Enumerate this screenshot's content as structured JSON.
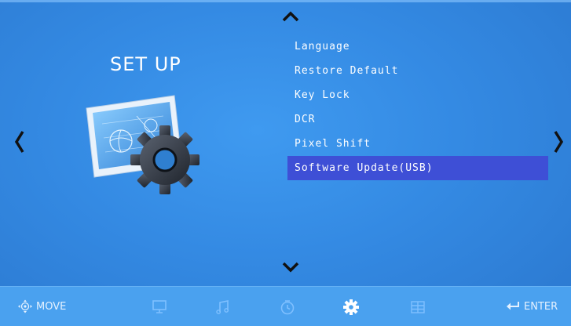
{
  "menu": {
    "title": "SET UP",
    "items": [
      {
        "label": "Language"
      },
      {
        "label": "Restore Default"
      },
      {
        "label": "Key Lock"
      },
      {
        "label": "DCR"
      },
      {
        "label": "Pixel Shift"
      },
      {
        "label": "Software Update(USB)"
      }
    ],
    "selected_index": 5
  },
  "footer": {
    "move_label": "MOVE",
    "enter_label": "ENTER"
  },
  "tabs": [
    {
      "icon": "monitor-icon"
    },
    {
      "icon": "music-note-icon"
    },
    {
      "icon": "clock-icon"
    },
    {
      "icon": "gear-icon",
      "active": true
    },
    {
      "icon": "grid-icon"
    }
  ],
  "colors": {
    "background": "#348ae3",
    "selection": "#3e4fd6",
    "bottom_bar": "#4aa1ef",
    "inactive_icon": "#7fc0ff"
  }
}
